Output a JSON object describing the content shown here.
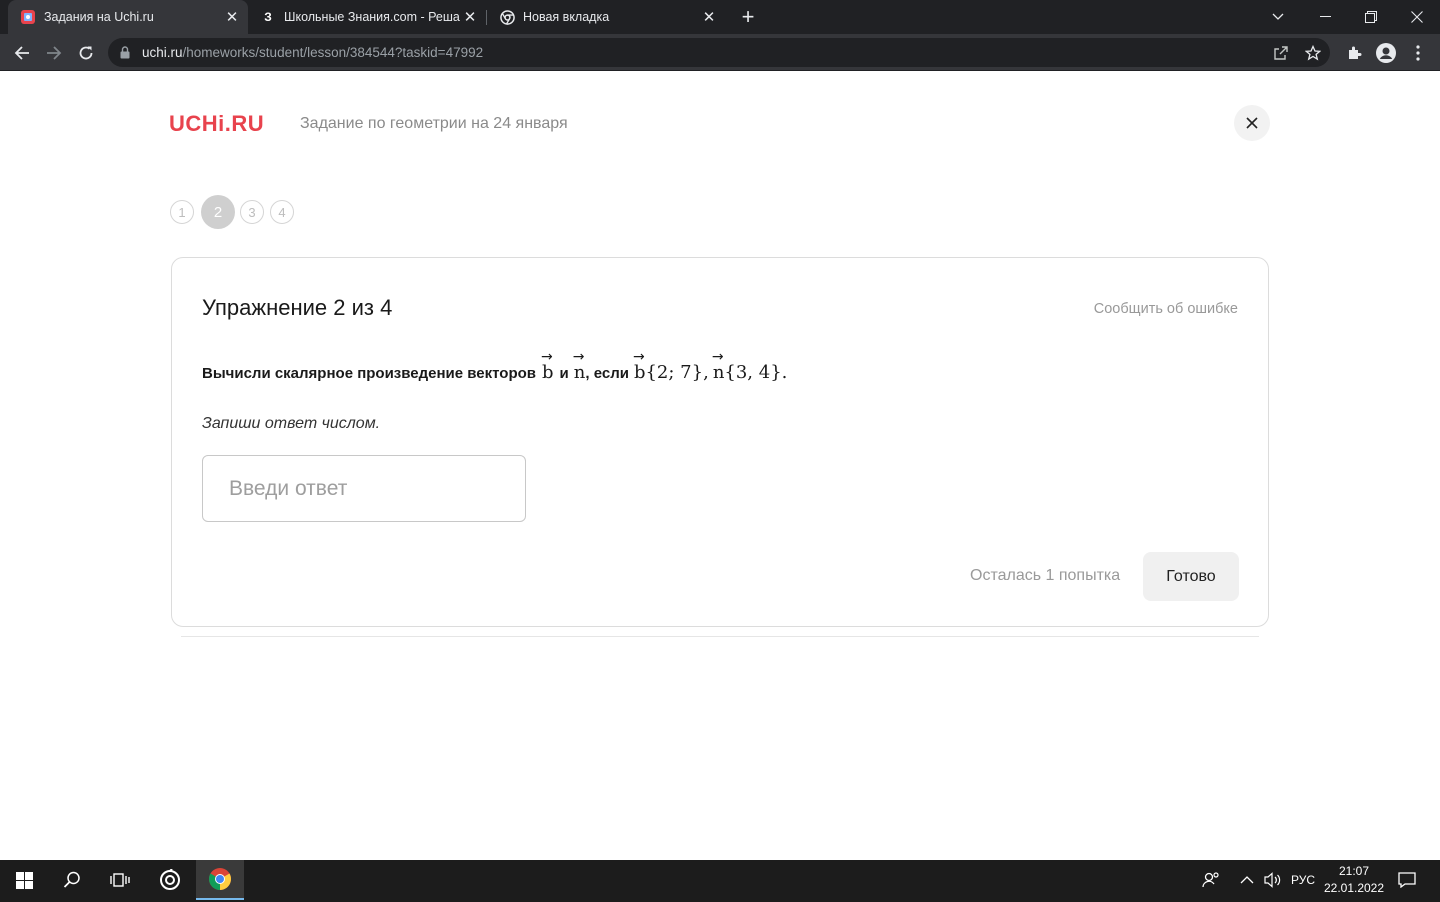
{
  "browser": {
    "tabs": [
      {
        "title": "Задания на Uchi.ru",
        "active": true
      },
      {
        "title": "Школьные Знания.com - Решае",
        "favicon_letter": "З"
      },
      {
        "title": "Новая вкладка"
      }
    ],
    "url_host": "uchi.ru",
    "url_path": "/homeworks/student/lesson/384544?taskid=47992"
  },
  "header": {
    "logo": "UCHi.RU",
    "lesson_title": "Задание по геометрии на 24 января"
  },
  "steps": [
    "1",
    "2",
    "3",
    "4"
  ],
  "current_step": 2,
  "exercise": {
    "title": "Упражнение 2 из 4",
    "report_link": "Сообщить об ошибке",
    "question_prefix": "Вычисли скалярное произведение векторов",
    "vec_b": "b",
    "conj_and": "и",
    "vec_n": "n",
    "conj_if": ", если",
    "b_coords": "{2; 7},",
    "n_coords": "{3, 4}.",
    "hint": "Запиши ответ числом.",
    "input_placeholder": "Введи ответ",
    "attempts": "Осталась 1 попытка",
    "submit": "Готово"
  },
  "taskbar": {
    "lang": "РУС",
    "time": "21:07",
    "date": "22.01.2022"
  },
  "colors": {
    "brand": "#e8434d",
    "chrome_dark": "#202124",
    "chrome_toolbar": "#35363a"
  }
}
